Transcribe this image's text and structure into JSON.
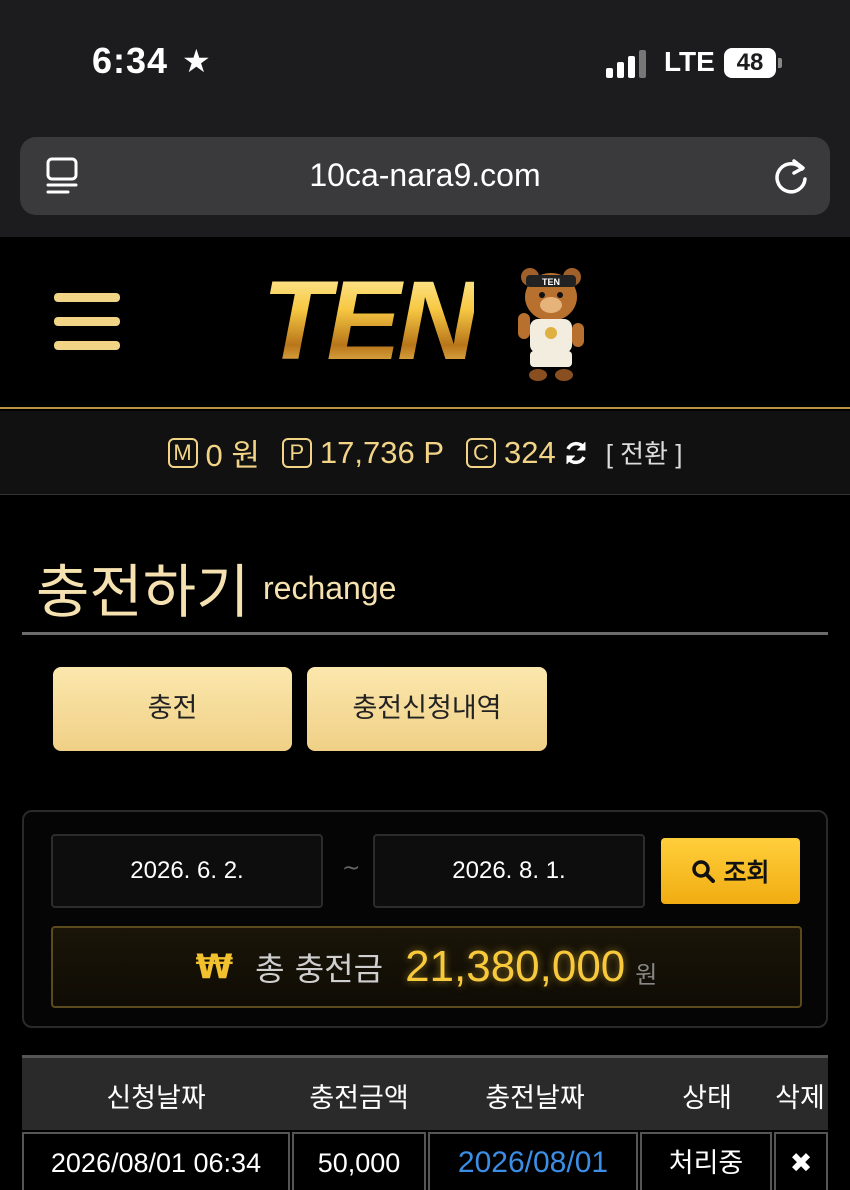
{
  "status": {
    "time": "6:34",
    "network": "LTE",
    "battery": "48"
  },
  "browser": {
    "url": "10ca-nara9.com"
  },
  "header": {
    "logo_text": "TEN",
    "mascot_text": "TEN"
  },
  "points": {
    "money_badge": "M",
    "money": "0 원",
    "point_badge": "P",
    "point": "17,736 P",
    "coin_badge": "C",
    "coin": "324",
    "switch_label": "[ 전환 ]"
  },
  "page": {
    "title": "충전하기",
    "subtitle": "rechange"
  },
  "tabs": [
    {
      "label": "충전"
    },
    {
      "label": "충전신청내역"
    }
  ],
  "filter": {
    "date_from": "2026. 6. 2.",
    "separator": "~",
    "date_to": "2026. 8. 1.",
    "search_label": "조회",
    "total_label": "총 충전금",
    "total_value": "21,380,000",
    "total_unit": "원",
    "currency_symbol": "₩"
  },
  "table": {
    "headers": [
      "신청날짜",
      "충전금액",
      "충전날짜",
      "상태",
      "삭제"
    ],
    "rows": [
      {
        "request_date": "2026/08/01 06:34",
        "amount": "50,000",
        "charge_date": "2026/08/01",
        "status": "처리중",
        "delete": "✖"
      }
    ]
  },
  "colors": {
    "gold": "#f1d486",
    "accent": "#f7c93b",
    "link": "#3a8ee6"
  }
}
